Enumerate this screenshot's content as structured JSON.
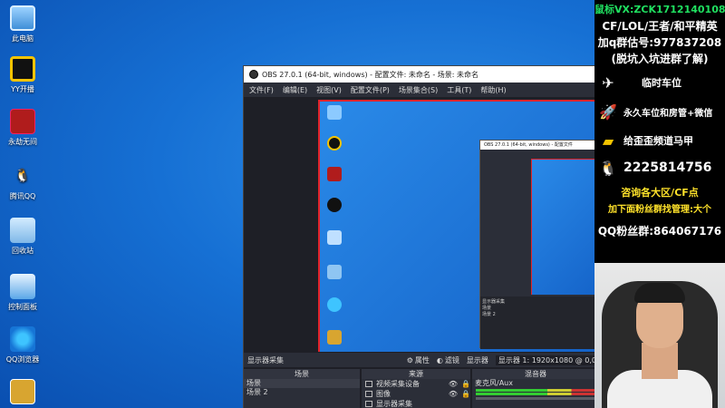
{
  "desktop_icons": [
    {
      "label": "此电脑",
      "icon": "computer-icon"
    },
    {
      "label": "YY开播",
      "icon": "yy-icon"
    },
    {
      "label": "永劫无间",
      "icon": "naraka-icon"
    },
    {
      "label": "腾讯QQ",
      "icon": "qq-penguin-icon"
    },
    {
      "label": "回收站",
      "icon": "recycle-bin-icon"
    },
    {
      "label": "控制面板",
      "icon": "control-panel-icon"
    },
    {
      "label": "QQ浏览器",
      "icon": "qq-browser-icon"
    },
    {
      "label": "",
      "icon": "document-icon"
    }
  ],
  "obs": {
    "title": "OBS 27.0.1 (64-bit, windows) - 配置文件: 未命名 - 场景: 未命名",
    "menu": [
      "文件(F)",
      "编辑(E)",
      "视图(V)",
      "配置文件(P)",
      "场景集合(S)",
      "工具(T)",
      "帮助(H)"
    ],
    "toolbar": {
      "source_label": "显示器采集",
      "properties": "属性",
      "filters": "滤镜",
      "display": "显示器",
      "display_value": "显示器 1: 1920x1080 @ 0,0"
    },
    "docks": {
      "scenes_header": "场景",
      "scenes": [
        "场景",
        "场景 2"
      ],
      "sources_header": "来源",
      "sources": [
        "视频采集设备",
        "图像",
        "显示器采集"
      ],
      "mixer_header": "混音器",
      "mixer_track": "麦克风/Aux"
    },
    "nested": {
      "title": "OBS 27.0.1 (64-bit, windows) - 配置文件",
      "dock_label": "显示器采集",
      "scenes": [
        "场景",
        "场景 2"
      ]
    }
  },
  "panel": {
    "line1": "鼠标VX:ZCK1712140108",
    "line2": "CF/LOL/王者/和平精英",
    "line3": "加q群估号:977837208",
    "line4": "(脱坑入坑进群了解)",
    "rows": [
      {
        "text": "临时车位",
        "icon": "airplane-icon"
      },
      {
        "text": "永久车位和房管+微信",
        "icon": "rocket-icon"
      },
      {
        "text": "给歪歪频道马甲",
        "icon": "gold-bar-icon"
      },
      {
        "text": "2225814756",
        "icon": "qq-penguin-icon"
      }
    ],
    "line5": "咨询各大区/CF点",
    "line6": "加下面粉丝群找管理:大个",
    "line7": "QQ粉丝群:864067176"
  }
}
